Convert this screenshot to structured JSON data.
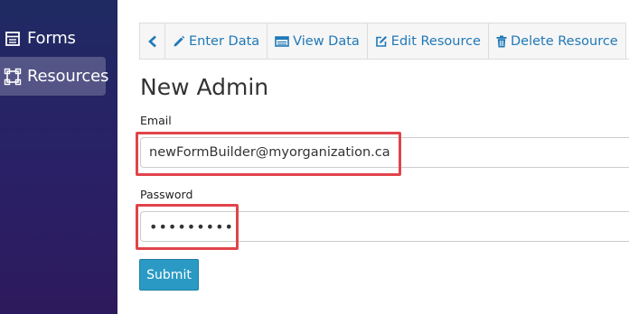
{
  "sidebar": {
    "items": [
      {
        "label": "Forms",
        "icon": "form-icon"
      },
      {
        "label": "Resources",
        "icon": "resources-icon",
        "active": true
      }
    ]
  },
  "tabs": [
    {
      "label": "",
      "icon": "chevron-left-icon"
    },
    {
      "label": "Enter Data",
      "icon": "pencil-icon"
    },
    {
      "label": "View Data",
      "icon": "table-icon"
    },
    {
      "label": "Edit Resource",
      "icon": "edit-icon"
    },
    {
      "label": "Delete Resource",
      "icon": "trash-icon"
    }
  ],
  "form": {
    "title": "New Admin",
    "email_label": "Email",
    "email_value": "newFormBuilder@myorganization.ca",
    "password_label": "Password",
    "password_value": "•••••••••",
    "submit_label": "Submit"
  },
  "colors": {
    "sidebar": "#24215f",
    "accent": "#1f78b8",
    "button": "#2a9ac5",
    "highlight": "#e0444a"
  }
}
